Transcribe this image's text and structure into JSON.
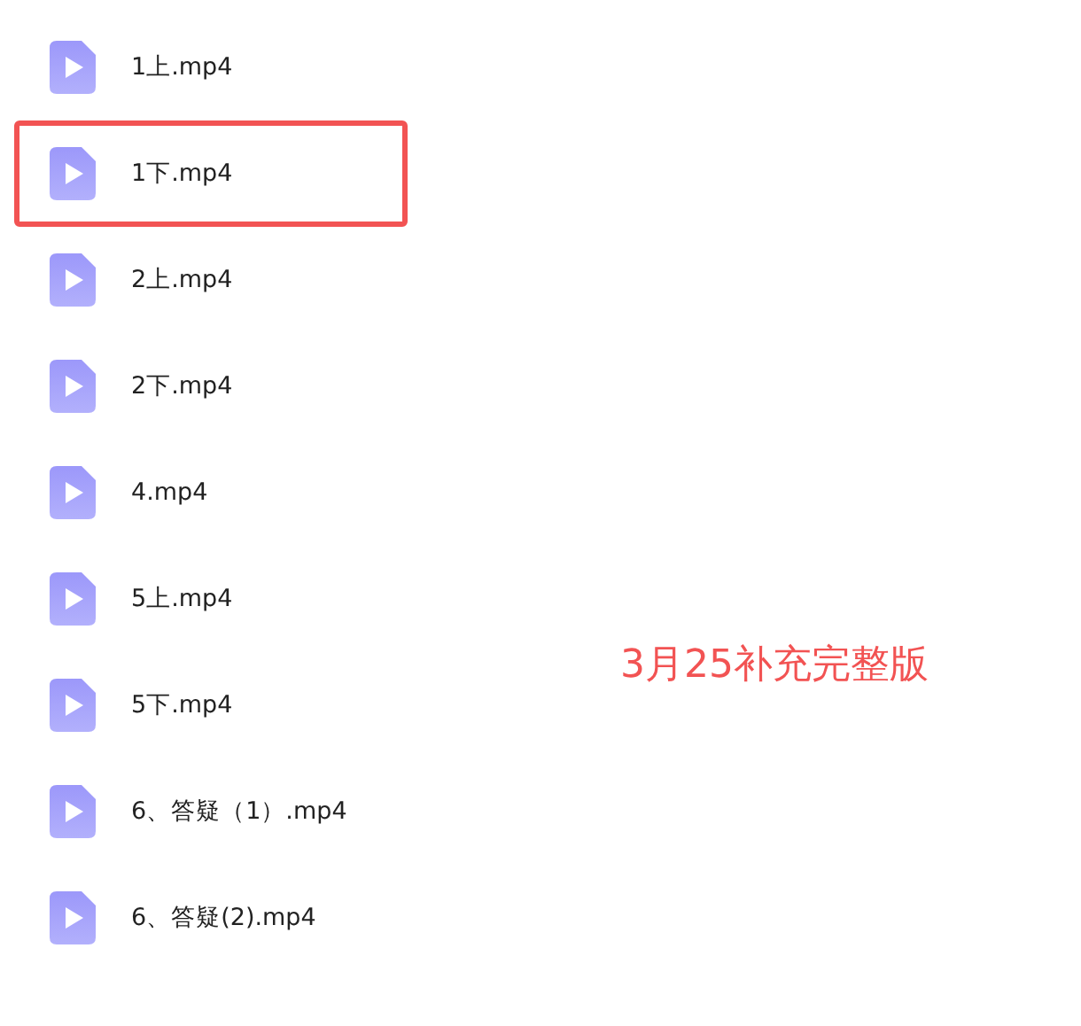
{
  "files": [
    {
      "name": "1上.mp4",
      "highlighted": false
    },
    {
      "name": "1下.mp4",
      "highlighted": true
    },
    {
      "name": "2上.mp4",
      "highlighted": false
    },
    {
      "name": "2下.mp4",
      "highlighted": false
    },
    {
      "name": "4.mp4",
      "highlighted": false
    },
    {
      "name": "5上.mp4",
      "highlighted": false
    },
    {
      "name": "5下.mp4",
      "highlighted": false
    },
    {
      "name": "6、答疑（1）.mp4",
      "highlighted": false
    },
    {
      "name": "6、答疑(2).mp4",
      "highlighted": false
    }
  ],
  "annotation": "3月25补充完整版"
}
